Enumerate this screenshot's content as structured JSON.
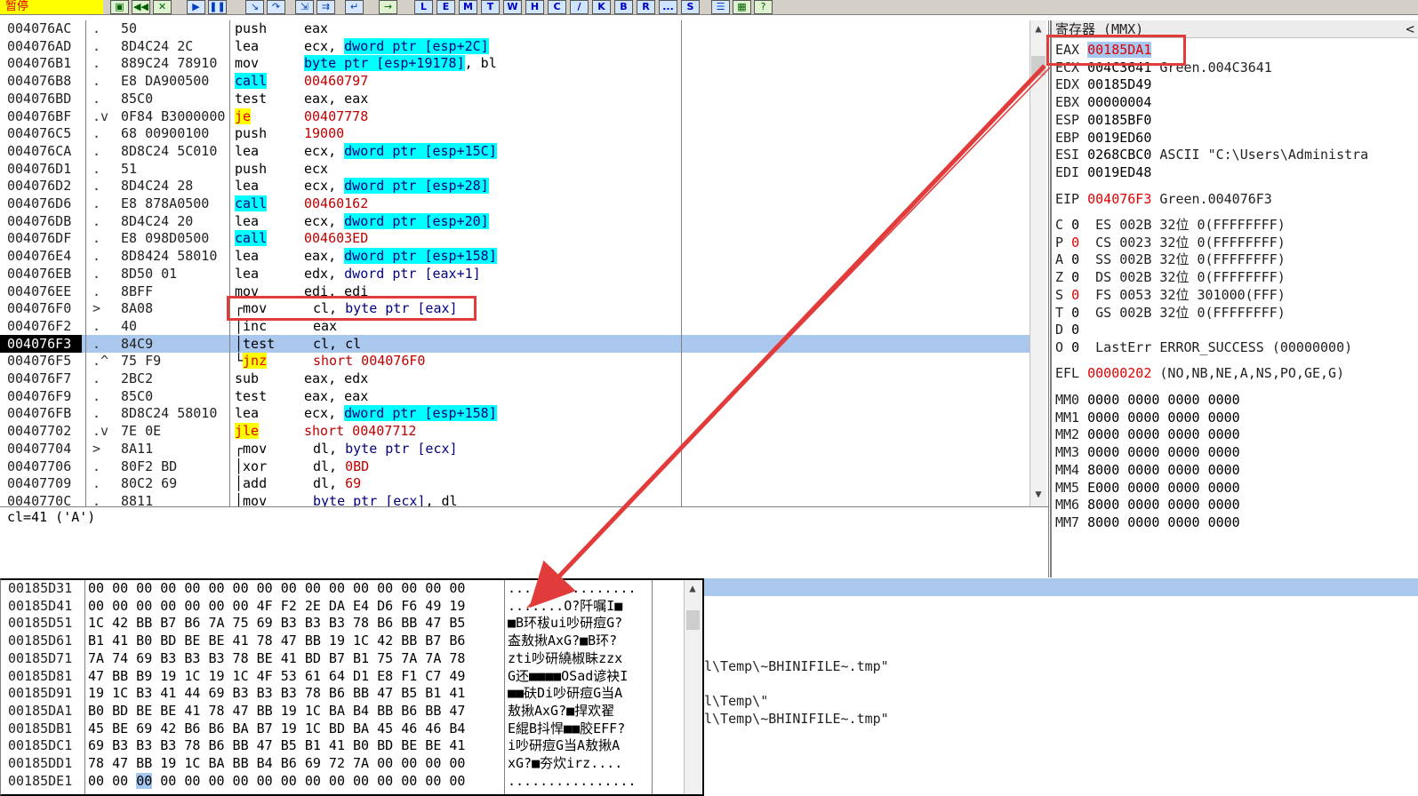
{
  "toolbar": {
    "status": "暂停",
    "buttons": [
      "L",
      "E",
      "M",
      "T",
      "W",
      "H",
      "C",
      "/",
      "K",
      "B",
      "R",
      "...",
      "S"
    ]
  },
  "disasm": {
    "rows": [
      {
        "addr": "004076AC",
        "gut": ".",
        "hex": "50",
        "mn": "push",
        "ops": [
          {
            "t": "eax"
          }
        ]
      },
      {
        "addr": "004076AD",
        "gut": ".",
        "hex": "8D4C24 2C",
        "mn": "lea",
        "ops": [
          {
            "t": "ecx, "
          },
          {
            "t": "dword ptr [esp+2C]",
            "c": "cyan"
          }
        ]
      },
      {
        "addr": "004076B1",
        "gut": ".",
        "hex": "889C24 78910",
        "mn": "mov",
        "ops": [
          {
            "t": "byte ptr [esp+19178]",
            "c": "cyan"
          },
          {
            "t": ", bl"
          }
        ]
      },
      {
        "addr": "004076B8",
        "gut": ".",
        "hex": "E8 DA900500",
        "mn": "call",
        "mnc": "cyan",
        "ops": [
          {
            "t": "00460797",
            "c": "red"
          }
        ]
      },
      {
        "addr": "004076BD",
        "gut": ".",
        "hex": "85C0",
        "mn": "test",
        "ops": [
          {
            "t": "eax, eax"
          }
        ]
      },
      {
        "addr": "004076BF",
        "gut": ".v",
        "hex": "0F84 B3000000",
        "mn": "je",
        "mnc": "yellow",
        "ops": [
          {
            "t": "00407778",
            "c": "red"
          }
        ]
      },
      {
        "addr": "004076C5",
        "gut": ".",
        "hex": "68 00900100",
        "mn": "push",
        "ops": [
          {
            "t": "19000",
            "c": "red"
          }
        ]
      },
      {
        "addr": "004076CA",
        "gut": ".",
        "hex": "8D8C24 5C010",
        "mn": "lea",
        "ops": [
          {
            "t": "ecx, "
          },
          {
            "t": "dword ptr [esp+15C]",
            "c": "cyan"
          }
        ]
      },
      {
        "addr": "004076D1",
        "gut": ".",
        "hex": "51",
        "mn": "push",
        "ops": [
          {
            "t": "ecx"
          }
        ]
      },
      {
        "addr": "004076D2",
        "gut": ".",
        "hex": "8D4C24 28",
        "mn": "lea",
        "ops": [
          {
            "t": "ecx, "
          },
          {
            "t": "dword ptr [esp+28]",
            "c": "cyan"
          }
        ]
      },
      {
        "addr": "004076D6",
        "gut": ".",
        "hex": "E8 878A0500",
        "mn": "call",
        "mnc": "cyan",
        "ops": [
          {
            "t": "00460162",
            "c": "red"
          }
        ]
      },
      {
        "addr": "004076DB",
        "gut": ".",
        "hex": "8D4C24 20",
        "mn": "lea",
        "ops": [
          {
            "t": "ecx, "
          },
          {
            "t": "dword ptr [esp+20]",
            "c": "cyan"
          }
        ]
      },
      {
        "addr": "004076DF",
        "gut": ".",
        "hex": "E8 098D0500",
        "mn": "call",
        "mnc": "cyan",
        "ops": [
          {
            "t": "004603ED",
            "c": "red"
          }
        ]
      },
      {
        "addr": "004076E4",
        "gut": ".",
        "hex": "8D8424 58010",
        "mn": "lea",
        "ops": [
          {
            "t": "eax, "
          },
          {
            "t": "dword ptr [esp+158]",
            "c": "cyan"
          }
        ]
      },
      {
        "addr": "004076EB",
        "gut": ".",
        "hex": "8D50 01",
        "mn": "lea",
        "ops": [
          {
            "t": "edx, "
          },
          {
            "t": "dword ptr [eax+1]",
            "c": "blue"
          }
        ]
      },
      {
        "addr": "004076EE",
        "gut": ".",
        "hex": "8BFF",
        "mn": "mov",
        "ops": [
          {
            "t": "edi, edi"
          }
        ]
      },
      {
        "addr": "004076F0",
        "gut": ">",
        "hex": "8A08",
        "mn": "┌mov",
        "ind": true,
        "ops": [
          {
            "t": "cl, "
          },
          {
            "t": "byte ptr [eax]",
            "c": "blue"
          }
        ]
      },
      {
        "addr": "004076F2",
        "gut": ".",
        "hex": "40",
        "mn": "│inc",
        "ind": true,
        "ops": [
          {
            "t": "eax"
          }
        ]
      },
      {
        "addr": "004076F3",
        "gut": ".",
        "hex": "84C9",
        "mn": "│test",
        "ind": true,
        "sel": true,
        "ops": [
          {
            "t": "cl, cl"
          }
        ]
      },
      {
        "addr": "004076F5",
        "gut": ".^",
        "hex": "75 F9",
        "mn": "└",
        "mn2": "jnz",
        "ind": true,
        "mnc": "yellow",
        "ops": [
          {
            "t": "short 004076F0",
            "c": "red"
          }
        ]
      },
      {
        "addr": "004076F7",
        "gut": ".",
        "hex": "2BC2",
        "mn": "sub",
        "ops": [
          {
            "t": "eax, edx"
          }
        ]
      },
      {
        "addr": "004076F9",
        "gut": ".",
        "hex": "85C0",
        "mn": "test",
        "ops": [
          {
            "t": "eax, eax"
          }
        ]
      },
      {
        "addr": "004076FB",
        "gut": ".",
        "hex": "8D8C24 58010",
        "mn": "lea",
        "ops": [
          {
            "t": "ecx, "
          },
          {
            "t": "dword ptr [esp+158]",
            "c": "cyan"
          }
        ]
      },
      {
        "addr": "00407702",
        "gut": ".v",
        "hex": "7E 0E",
        "mn": "jle",
        "mnc": "yellow",
        "ops": [
          {
            "t": "short 00407712",
            "c": "red"
          }
        ]
      },
      {
        "addr": "00407704",
        "gut": ">",
        "hex": "8A11",
        "mn": "┌mov",
        "ind": true,
        "ops": [
          {
            "t": "dl, "
          },
          {
            "t": "byte ptr [ecx]",
            "c": "blue"
          }
        ]
      },
      {
        "addr": "00407706",
        "gut": ".",
        "hex": "80F2 BD",
        "mn": "│xor",
        "ind": true,
        "ops": [
          {
            "t": "dl, "
          },
          {
            "t": "0BD",
            "c": "red"
          }
        ]
      },
      {
        "addr": "00407709",
        "gut": ".",
        "hex": "80C2 69",
        "mn": "│add",
        "ind": true,
        "ops": [
          {
            "t": "dl, "
          },
          {
            "t": "69",
            "c": "red"
          }
        ]
      },
      {
        "addr": "0040770C",
        "gut": ".",
        "hex": "8811",
        "mn": "│mov",
        "ind": true,
        "ops": [
          {
            "t": "byte ptr [ecx]",
            "c": "blue"
          },
          {
            "t": ", dl"
          }
        ]
      }
    ]
  },
  "info": {
    "text": "cl=41 ('A')"
  },
  "registers": {
    "title": "寄存器 (MMX)",
    "collapse": "<",
    "gp": [
      {
        "n": "EAX",
        "v": "00185DA1",
        "sel": true,
        "extra": ""
      },
      {
        "n": "ECX",
        "v": "004C3641",
        "extra": "Green.004C3641"
      },
      {
        "n": "EDX",
        "v": "00185D49",
        "extra": ""
      },
      {
        "n": "EBX",
        "v": "00000004",
        "extra": ""
      },
      {
        "n": "ESP",
        "v": "00185BF0",
        "extra": ""
      },
      {
        "n": "EBP",
        "v": "0019ED60",
        "extra": ""
      },
      {
        "n": "ESI",
        "v": "0268CBC0",
        "extra": "ASCII \"C:\\Users\\Administra"
      },
      {
        "n": "EDI",
        "v": "0019ED48",
        "extra": ""
      }
    ],
    "eip": {
      "n": "EIP",
      "v": "004076F3",
      "extra": "Green.004076F3"
    },
    "flags": [
      {
        "f": "C",
        "v": "0",
        "red": false,
        "seg": "ES 002B 32位 0(FFFFFFFF)"
      },
      {
        "f": "P",
        "v": "0",
        "red": true,
        "seg": "CS 0023 32位 0(FFFFFFFF)"
      },
      {
        "f": "A",
        "v": "0",
        "red": false,
        "seg": "SS 002B 32位 0(FFFFFFFF)"
      },
      {
        "f": "Z",
        "v": "0",
        "red": false,
        "seg": "DS 002B 32位 0(FFFFFFFF)"
      },
      {
        "f": "S",
        "v": "0",
        "red": true,
        "seg": "FS 0053 32位 301000(FFF)"
      },
      {
        "f": "T",
        "v": "0",
        "red": false,
        "seg": "GS 002B 32位 0(FFFFFFFF)"
      },
      {
        "f": "D",
        "v": "0",
        "red": false,
        "seg": ""
      },
      {
        "f": "O",
        "v": "0",
        "red": false,
        "seg": "LastErr ERROR_SUCCESS (00000000)"
      }
    ],
    "efl": {
      "n": "EFL",
      "v": "00000202",
      "extra": "(NO,NB,NE,A,NS,PO,GE,G)"
    },
    "mmx": [
      {
        "n": "MM0",
        "v": "0000 0000 0000 0000"
      },
      {
        "n": "MM1",
        "v": "0000 0000 0000 0000"
      },
      {
        "n": "MM2",
        "v": "0000 0000 0000 0000"
      },
      {
        "n": "MM3",
        "v": "0000 0000 0000 0000"
      },
      {
        "n": "MM4",
        "v": "8000 0000 0000 0000"
      },
      {
        "n": "MM5",
        "v": "E000 0000 0000 0000"
      },
      {
        "n": "MM6",
        "v": "8000 0000 0000 0000"
      },
      {
        "n": "MM7",
        "v": "8000 0000 0000 0000"
      }
    ]
  },
  "dump": {
    "rows": [
      {
        "addr": "00185D31",
        "hex": "00 00 00 00 00 00 00 00 00 00 00 00 00 00 00 00",
        "ascii": "................"
      },
      {
        "addr": "00185D41",
        "hex": "00 00 00 00 00 00 00 4F F2 2E DA E4 D6 F6 49 19",
        "ascii": ".......O?阡嘱I■"
      },
      {
        "addr": "00185D51",
        "hex": "1C 42 BB B7 B6 7A 75 69 B3 B3 B3 78 B6 BB 47 B5",
        "ascii": "■B环秡ui吵研痘G?"
      },
      {
        "addr": "00185D61",
        "hex": "B1 41 B0 BD BE BE 41 78 47 BB 19 1C 42 BB B7 B6",
        "ascii": "盇敖揪AxG?■B环?"
      },
      {
        "addr": "00185D71",
        "hex": "7A 74 69 B3 B3 B3 78 BE 41 BD B7 B1 75 7A 7A 78",
        "ascii": "zti吵研繞椒眛zzx"
      },
      {
        "addr": "00185D81",
        "hex": "47 BB B9 19 1C 19 1C 4F 53 61 64 D1 E8 F1 C7 49",
        "ascii": "G还■■■■OSad谚袂I"
      },
      {
        "addr": "00185D91",
        "hex": "19 1C B3 41 44 69 B3 B3 B3 78 B6 BB 47 B5 B1 41",
        "ascii": "■■砆Di吵研痘G当A"
      },
      {
        "addr": "00185DA1",
        "hex": "B0 BD BE BE 41 78 47 BB 19 1C BA B4 BB B6 BB 47",
        "ascii": "敖揪AxG?■捍欢翟"
      },
      {
        "addr": "00185DB1",
        "hex": "45 BE 69 42 B6 B6 BA B7 19 1C BD BA 45 46 46 B4",
        "ascii": "E緄B抖悍■■胶EFF?"
      },
      {
        "addr": "00185DC1",
        "hex": "69 B3 B3 B3 78 B6 BB 47 B5 B1 41 B0 BD BE BE 41",
        "ascii": "i吵研痘G当A敖揪A"
      },
      {
        "addr": "00185DD1",
        "hex": "78 47 BB 19 1C BA BB B4 B6 69 72 7A 00 00 00 00",
        "ascii": "xG?■夯炊irz...."
      },
      {
        "addr": "00185DE1",
        "hex": "00 00 00 00 00 00 00 00 00 00 00 00 00 00 00 00",
        "ascii": "................"
      }
    ]
  },
  "stack": {
    "lines": [
      {
        "row": 4,
        "text": "l\\Temp\\~BHINIFILE~.tmp\""
      },
      {
        "row": 6,
        "text": "l\\Temp\\\""
      },
      {
        "row": 7,
        "text": "l\\Temp\\~BHINIFILE~.tmp\""
      }
    ]
  }
}
